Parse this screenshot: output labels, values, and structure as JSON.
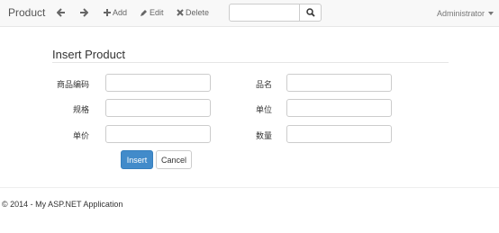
{
  "navbar": {
    "brand": "Product",
    "back_icon": "arrow-left-icon",
    "forward_icon": "arrow-right-icon",
    "add_label": "Add",
    "edit_label": "Edit",
    "delete_label": "Delete",
    "search_value": "",
    "search_icon": "search-icon",
    "user_label": "Administrator"
  },
  "form": {
    "title": "Insert Product",
    "fields": [
      {
        "label": "商品编码",
        "value": ""
      },
      {
        "label": "品名",
        "value": ""
      },
      {
        "label": "规格",
        "value": ""
      },
      {
        "label": "单位",
        "value": ""
      },
      {
        "label": "单价",
        "value": ""
      },
      {
        "label": "数量",
        "value": ""
      }
    ],
    "insert_label": "Insert",
    "cancel_label": "Cancel"
  },
  "footer": {
    "text": "© 2014 - My ASP.NET Application"
  },
  "colors": {
    "primary": "#428bca",
    "navbar_bg": "#f8f8f8"
  }
}
